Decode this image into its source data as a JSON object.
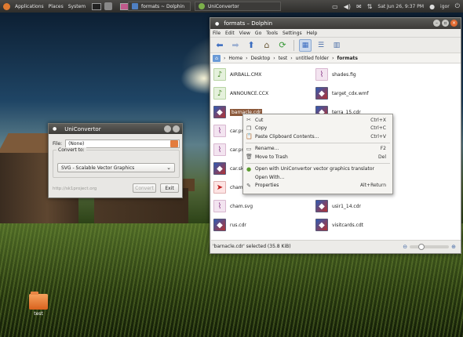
{
  "panel": {
    "menus": [
      "Applications",
      "Places",
      "System"
    ],
    "tasks": [
      {
        "label": "formats ~ Dolphin",
        "icon": "dolphin-icon"
      },
      {
        "label": "UniConvertor",
        "icon": "uniconvertor-icon"
      }
    ],
    "clock": "Sat Jun 26,  9:37 PM",
    "user": "igor"
  },
  "dolphin": {
    "title": "formats – Dolphin",
    "menu": [
      "File",
      "Edit",
      "View",
      "Go",
      "Tools",
      "Settings",
      "Help"
    ],
    "breadcrumb": [
      "Home",
      "Desktop",
      "test",
      "untitled folder",
      "formats"
    ],
    "files_left": [
      {
        "name": "AIRBALL.CMX",
        "icon": "music"
      },
      {
        "name": "ANNOUNCE.CCX",
        "icon": "music"
      },
      {
        "name": "barnacle.cdr",
        "icon": "cdr"
      },
      {
        "name": "car.ps",
        "icon": "fig"
      },
      {
        "name": "car.ps.",
        "icon": "fig"
      },
      {
        "name": "car.sk1",
        "icon": "cdr"
      },
      {
        "name": "cham.a",
        "icon": "svg"
      },
      {
        "name": "cham.svg",
        "icon": "fig"
      },
      {
        "name": "rus.cdr",
        "icon": "cdr"
      }
    ],
    "files_right": [
      {
        "name": "shades.fig",
        "icon": "fig"
      },
      {
        "name": "target_cdx.wmf",
        "icon": "cdr"
      },
      {
        "name": "terra_15.cdr",
        "icon": "cdr"
      },
      {
        "name": "usir1_14.cdr",
        "icon": "cdr"
      },
      {
        "name": "visitcards.cdt",
        "icon": "cdr"
      }
    ],
    "status": "'barnacle.cdr' selected (35.8 KiB)",
    "zoom_level": 0.3
  },
  "context_menu": {
    "items": [
      {
        "label": "Cut",
        "shortcut": "Ctrl+X",
        "icon": "scissors-icon"
      },
      {
        "label": "Copy",
        "shortcut": "Ctrl+C",
        "icon": "copy-icon"
      },
      {
        "label": "Paste Clipboard Contents...",
        "shortcut": "Ctrl+V",
        "icon": "paste-icon"
      },
      {
        "label": "Rename...",
        "shortcut": "F2",
        "icon": "rename-icon"
      },
      {
        "label": "Move to Trash",
        "shortcut": "Del",
        "icon": "trash-icon"
      },
      {
        "label": "Open with UniConvertor vector graphics translator",
        "shortcut": "",
        "icon": "uniconvertor-icon"
      },
      {
        "label": "Open With...",
        "shortcut": "",
        "icon": ""
      },
      {
        "label": "Properties",
        "shortcut": "Alt+Return",
        "icon": "properties-icon"
      }
    ]
  },
  "uniconvertor": {
    "title": "UniConvertor",
    "file_label": "File:",
    "file_value": "(None)",
    "convert_label": "Convert to:",
    "format": "SVG - Scalable Vector Graphics",
    "link": "http://sk1project.org",
    "convert_button": "Convert",
    "exit_button": "Exit"
  },
  "desktop": {
    "folder_label": "test"
  }
}
